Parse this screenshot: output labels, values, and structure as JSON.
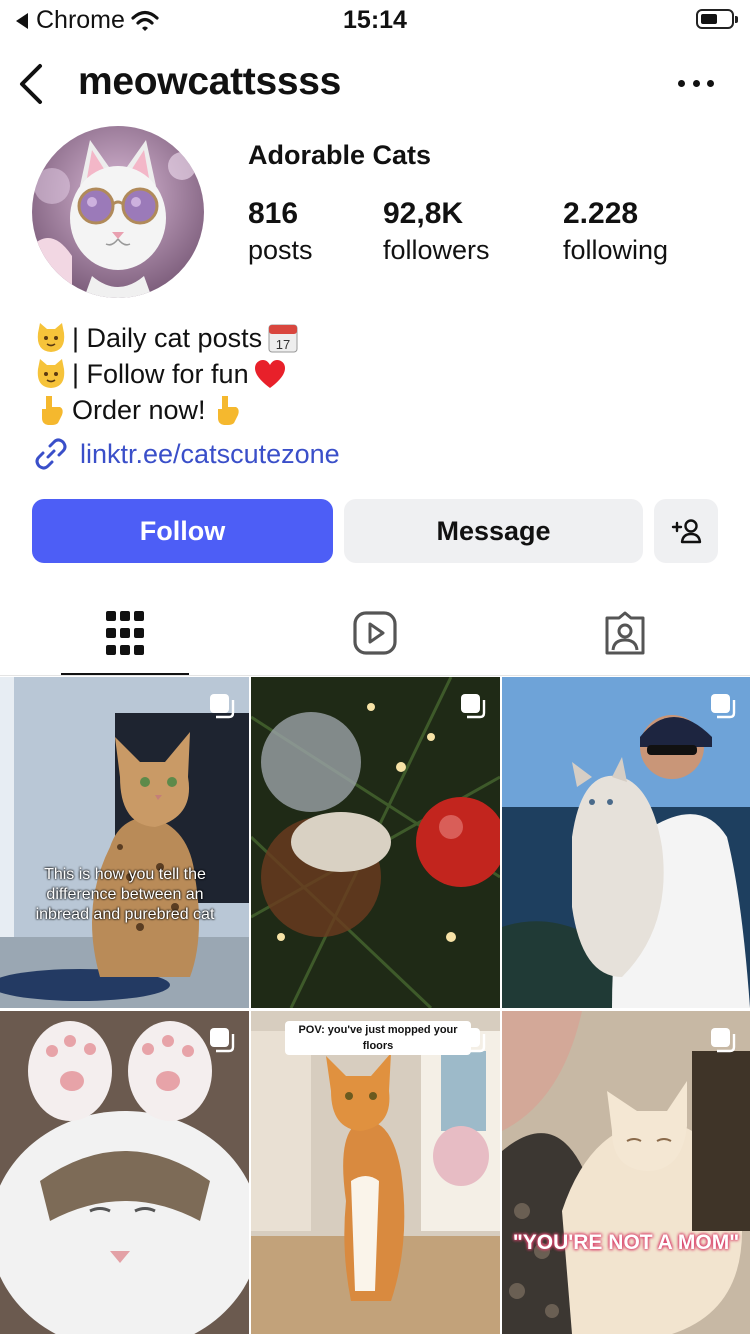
{
  "status_bar": {
    "back_app": "Chrome",
    "time": "15:14"
  },
  "header": {
    "username": "meowcattssss"
  },
  "profile": {
    "display_name": "Adorable Cats",
    "stats": [
      {
        "value": "816",
        "label": "posts"
      },
      {
        "value": "92,8K",
        "label": "followers"
      },
      {
        "value": "2.228",
        "label": "following"
      }
    ],
    "bio": [
      {
        "text": "| Daily cat posts"
      },
      {
        "text": "| Follow for fun"
      },
      {
        "text": "Order now!"
      }
    ],
    "link": "linktr.ee/catscutezone"
  },
  "actions": {
    "follow": "Follow",
    "message": "Message"
  },
  "tabs": [
    "grid-icon",
    "reels-icon",
    "tagged-icon"
  ],
  "posts": [
    {
      "caption": "This is how you tell the difference between an inbread and purebred cat"
    },
    {
      "caption": ""
    },
    {
      "caption": ""
    },
    {
      "caption": ""
    },
    {
      "caption": "POV: you've just mopped your floors"
    },
    {
      "caption": "\"YOU'RE NOT A MOM\""
    }
  ],
  "colors": {
    "accent": "#4d5ef6",
    "link": "#3a4fc9",
    "secondary_button": "#eff0f2"
  }
}
